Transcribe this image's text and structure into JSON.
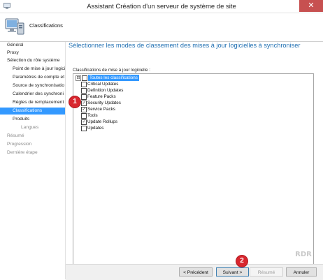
{
  "window": {
    "title": "Assistant Création d'un serveur de système de site",
    "close_glyph": "✕"
  },
  "header": {
    "title": "Classifications"
  },
  "sidebar": {
    "items": [
      {
        "label": "Général",
        "level": 1,
        "state": "normal"
      },
      {
        "label": "Proxy",
        "level": 1,
        "state": "normal"
      },
      {
        "label": "Sélection du rôle système",
        "level": 1,
        "state": "normal"
      },
      {
        "label": "Point de mise à jour logicie",
        "level": 2,
        "state": "normal"
      },
      {
        "label": "Paramètres de compte et",
        "level": 2,
        "state": "normal"
      },
      {
        "label": "Source de synchronisatio",
        "level": 2,
        "state": "normal"
      },
      {
        "label": "Calendrier des synchroni",
        "level": 2,
        "state": "normal"
      },
      {
        "label": "Règles de remplacement",
        "level": 2,
        "state": "normal"
      },
      {
        "label": "Classifications",
        "level": 2,
        "state": "active"
      },
      {
        "label": "Produits",
        "level": 2,
        "state": "normal"
      },
      {
        "label": "Langues",
        "level": 3,
        "state": "dim"
      },
      {
        "label": "Résumé",
        "level": 1,
        "state": "dim"
      },
      {
        "label": "Progression",
        "level": 1,
        "state": "dim"
      },
      {
        "label": "Dernière étape",
        "level": 1,
        "state": "dim"
      }
    ]
  },
  "main": {
    "heading": "Sélectionner les modes de classement des mises à jour logicielles à synchroniser",
    "list_label": "Classifications de mise à jour logicielle :",
    "tree": {
      "expander": "⊟",
      "root_label": "Toutes les classifications",
      "root_checked": false,
      "children": [
        {
          "label": "Critical Updates",
          "checked": false
        },
        {
          "label": "Definition Updates",
          "checked": false
        },
        {
          "label": "Feature Packs",
          "checked": false
        },
        {
          "label": "Security Updates",
          "checked": true
        },
        {
          "label": "Service Packs",
          "checked": true
        },
        {
          "label": "Tools",
          "checked": false
        },
        {
          "label": "Update Rollups",
          "checked": true
        },
        {
          "label": "Updates",
          "checked": false
        }
      ]
    }
  },
  "footer": {
    "prev_label": "< Précédent",
    "next_label": "Suivant >",
    "summary_label": "Résumé",
    "cancel_label": "Annuler"
  },
  "annotations": {
    "step1": "1",
    "step2": "2"
  },
  "watermark": "RDR",
  "colors": {
    "accent": "#3399ff",
    "heading": "#1f6fb2",
    "close": "#c75050",
    "badge": "#d8262e"
  }
}
